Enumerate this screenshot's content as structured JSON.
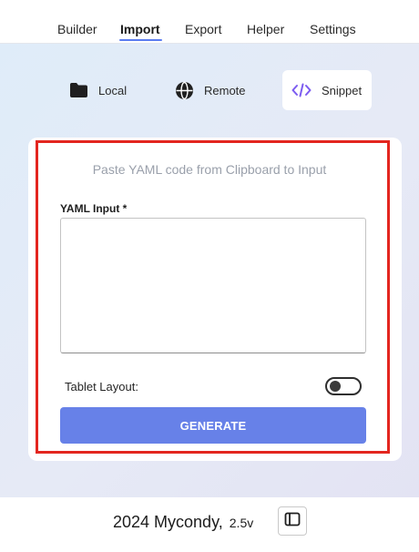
{
  "nav": {
    "tabs": [
      {
        "label": "Builder"
      },
      {
        "label": "Import"
      },
      {
        "label": "Export"
      },
      {
        "label": "Helper"
      },
      {
        "label": "Settings"
      }
    ],
    "active_tab": "Import"
  },
  "sources": {
    "local": {
      "label": "Local",
      "icon": "folder-icon"
    },
    "remote": {
      "label": "Remote",
      "icon": "globe-icon"
    },
    "snippet": {
      "label": "Snippet",
      "icon": "code-icon"
    },
    "selected": "Snippet"
  },
  "card": {
    "hint": "Paste YAML code from Clipboard to Input",
    "yaml_label": "YAML Input *",
    "yaml_value": "",
    "toggle_label": "Tablet Layout:",
    "toggle_on": false,
    "generate_label": "GENERATE"
  },
  "footer": {
    "text": "2024 Mycondy,",
    "version": "2.5v",
    "layout_icon": "sidebar-layout-icon"
  },
  "colors": {
    "accent": "#6781e8",
    "highlight": "#e3261f",
    "snippet_icon": "#7c5cf0"
  }
}
